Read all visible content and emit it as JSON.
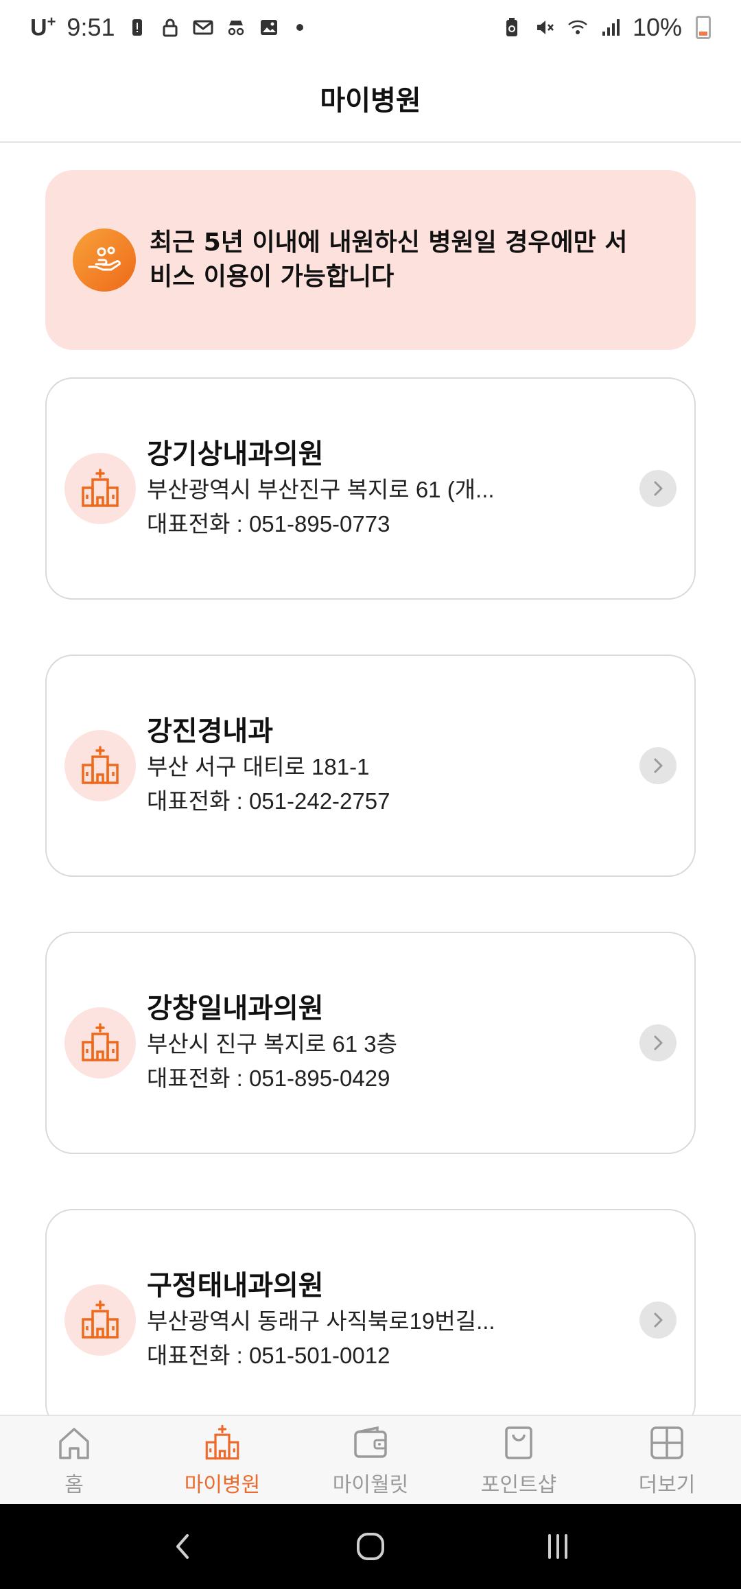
{
  "status_bar": {
    "carrier": "U",
    "carrier_sup": "+",
    "time": "9:51",
    "battery": "10%"
  },
  "header": {
    "title": "마이병원"
  },
  "notice": {
    "text_line1": "최근 5년 이내에 내원하신 병원일 경우에만 서",
    "text_line2": "비스 이용이 가능합니다"
  },
  "hospitals": [
    {
      "name": "강기상내과의원",
      "address": "부산광역시 부산진구 복지로 61 (개...",
      "phone": "대표전화 : 051-895-0773"
    },
    {
      "name": "강진경내과",
      "address": "부산 서구 대티로 181-1",
      "phone": "대표전화 : 051-242-2757"
    },
    {
      "name": "강창일내과의원",
      "address": "부산시 진구 복지로 61 3층",
      "phone": "대표전화 : 051-895-0429"
    },
    {
      "name": "구정태내과의원",
      "address": "부산광역시 동래구 사직북로19번길...",
      "phone": "대표전화 : 051-501-0012"
    }
  ],
  "bottom_nav": {
    "items": [
      {
        "label": "홈",
        "icon": "home-icon"
      },
      {
        "label": "마이병원",
        "icon": "hospital-icon",
        "active": true
      },
      {
        "label": "마이월릿",
        "icon": "wallet-icon"
      },
      {
        "label": "포인트샵",
        "icon": "shopping-bag-icon"
      },
      {
        "label": "더보기",
        "icon": "grid-icon"
      }
    ]
  },
  "colors": {
    "accent": "#ec6a2c",
    "notice_bg": "#fde1dd",
    "icon_bg": "#fde3df"
  }
}
